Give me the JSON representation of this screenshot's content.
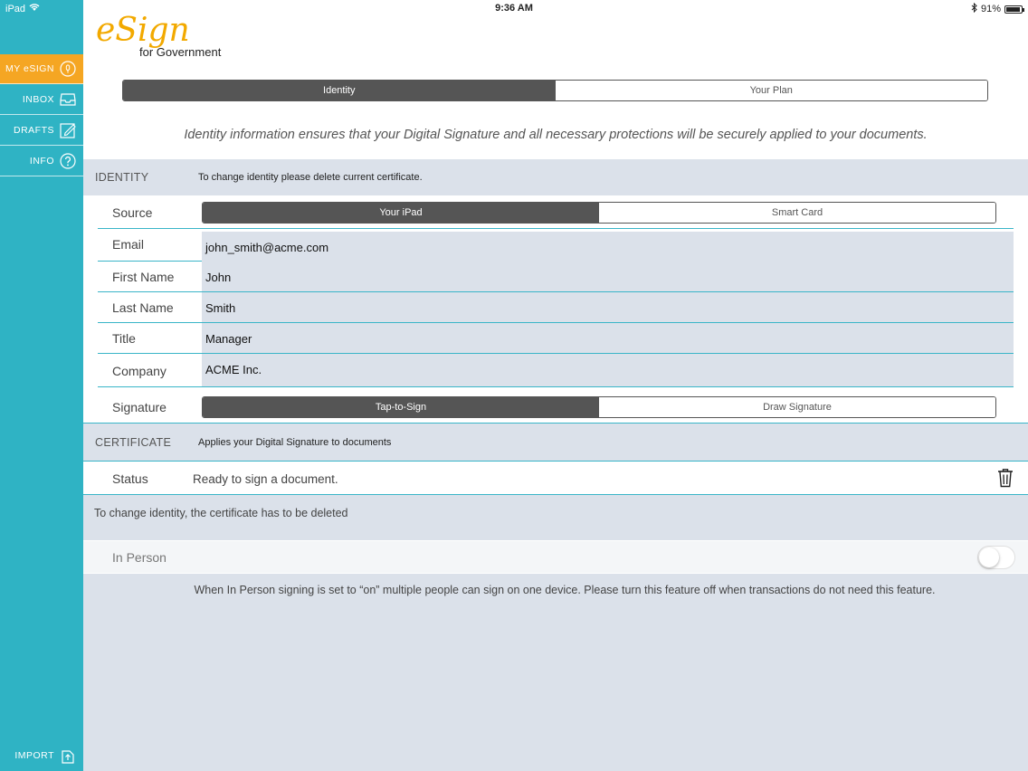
{
  "status_bar": {
    "device": "iPad",
    "time": "9:36 AM",
    "battery": "91%",
    "battery_level": 0.91
  },
  "sidebar": {
    "items": [
      {
        "label": "MY eSIGN",
        "icon": "user-icon"
      },
      {
        "label": "INBOX",
        "icon": "inbox-icon"
      },
      {
        "label": "DRAFTS",
        "icon": "edit-icon"
      },
      {
        "label": "INFO",
        "icon": "help-icon"
      }
    ],
    "import_label": "IMPORT",
    "colors": {
      "background": "#2fb3c4",
      "active": "#f5a623"
    }
  },
  "logo": {
    "brand": "eSign",
    "tagline": "for Government"
  },
  "top_tabs": {
    "identity": "Identity",
    "plan": "Your Plan"
  },
  "intro": "Identity information ensures that your Digital Signature and all necessary protections will be securely applied to your documents.",
  "identity_section": {
    "title": "IDENTITY",
    "desc": "To change identity please delete current certificate."
  },
  "source": {
    "label": "Source",
    "option1": "Your iPad",
    "option2": "Smart Card"
  },
  "fields": {
    "email": {
      "label": "Email",
      "value": "john_smith@acme.com"
    },
    "first_name": {
      "label": "First Name",
      "value": "John"
    },
    "last_name": {
      "label": "Last Name",
      "value": "Smith"
    },
    "title": {
      "label": "Title",
      "value": "Manager"
    },
    "company": {
      "label": "Company",
      "value": "ACME Inc."
    }
  },
  "signature": {
    "label": "Signature",
    "option1": "Tap-to-Sign",
    "option2": "Draw Signature"
  },
  "certificate_section": {
    "title": "CERTIFICATE",
    "desc": "Applies your Digital Signature to documents"
  },
  "status": {
    "label": "Status",
    "value": "Ready to sign a document."
  },
  "change_note": "To change identity, the certificate has to be deleted",
  "in_person": {
    "label": "In Person",
    "enabled": false
  },
  "in_person_note": "When In Person signing is set to “on” multiple people can sign on one device. Please turn this feature off when transactions do not need this feature."
}
